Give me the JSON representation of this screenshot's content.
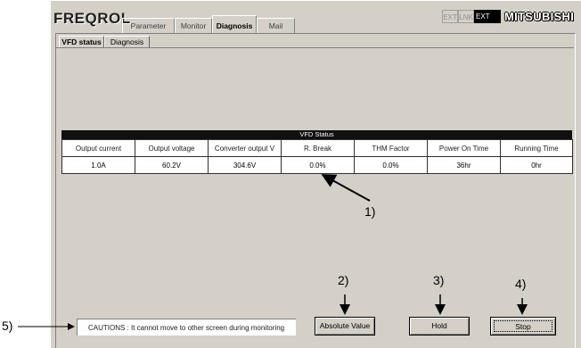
{
  "app": {
    "title": "FREQROL",
    "maker": "MITSUBISHI"
  },
  "tabs": [
    {
      "label": "Parameter",
      "active": false
    },
    {
      "label": "Monitor",
      "active": false
    },
    {
      "label": "Diagnosis",
      "active": true
    },
    {
      "label": "Mail",
      "active": false
    }
  ],
  "indicators": {
    "ext1": "EXT",
    "lnk": "LNK",
    "ext2": "EXT"
  },
  "subtabs": [
    {
      "label": "VFD status",
      "active": true
    },
    {
      "label": "Diagnosis",
      "active": false
    }
  ],
  "grid": {
    "title": "VFD Status",
    "headers": [
      "Output current",
      "Output voltage",
      "Converter output V",
      "R. Break",
      "THM Factor",
      "Power On Time",
      "Running Time"
    ],
    "values": [
      "1.0A",
      "60.2V",
      "304.6V",
      "0.0%",
      "0.0%",
      "36hr",
      "0hr"
    ]
  },
  "buttons": {
    "absolute_value": "Absolute Value",
    "hold": "Hold",
    "stop": "Stop"
  },
  "cautions": "CAUTIONS : It cannot move to other screen during monitoring",
  "annotations": {
    "a1": "1)",
    "a2": "2)",
    "a3": "3)",
    "a4": "4)",
    "a5": "5)"
  },
  "colors": {
    "panel": "#d4d0c8",
    "grid_title_bg": "#101010"
  }
}
